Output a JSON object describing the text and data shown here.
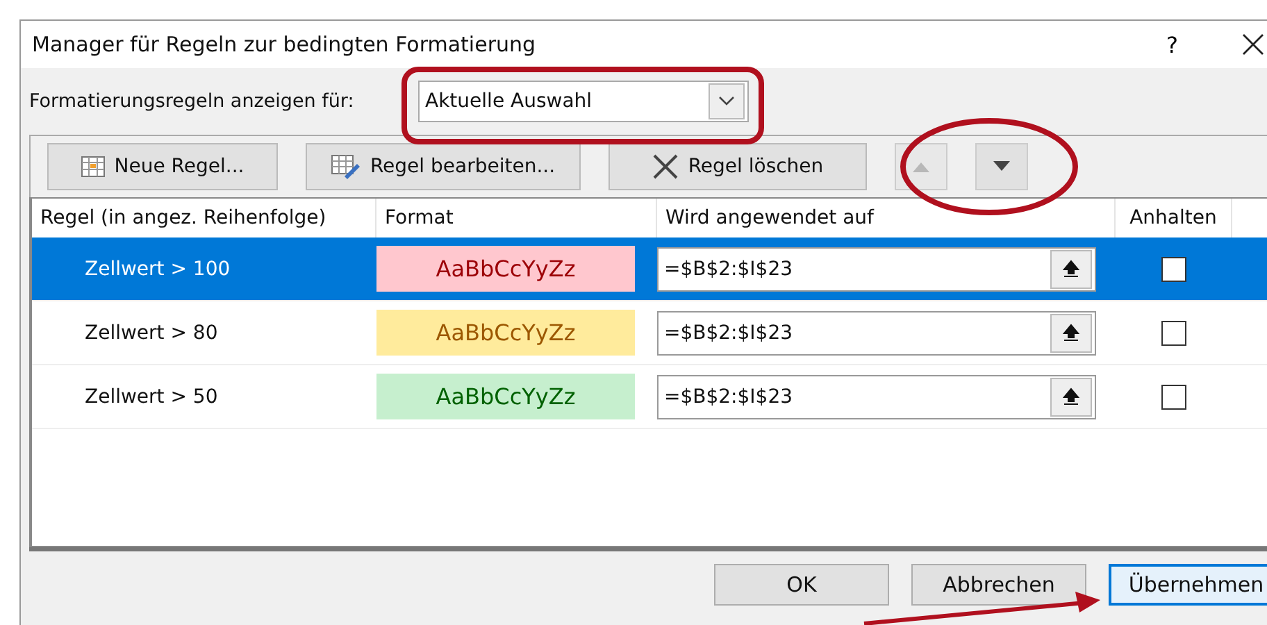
{
  "window": {
    "title": "Manager für Regeln zur bedingten Formatierung",
    "help": "?"
  },
  "filter": {
    "label": "Formatierungsregeln anzeigen für:",
    "value": "Aktuelle Auswahl"
  },
  "toolbar": [
    {
      "kind": "new",
      "label": "Neue Regel...",
      "disabled": false
    },
    {
      "kind": "edit",
      "label": "Regel bearbeiten...",
      "disabled": false
    },
    {
      "kind": "delete",
      "label": "Regel löschen",
      "disabled": false
    },
    {
      "kind": "up",
      "disabled": true
    },
    {
      "kind": "down",
      "disabled": false
    }
  ],
  "table": {
    "columns": [
      "Regel (in angez. Reihenfolge)",
      "Format",
      "Wird angewendet auf",
      "Anhalten"
    ],
    "rows": [
      {
        "rule": "Zellwert > 100",
        "format": {
          "kind": "bad",
          "color": "#ffc7ce",
          "sample": "AaBbCcYyZz"
        },
        "applies_to": "=$B$2:$I$23",
        "checked": false,
        "selected": true
      },
      {
        "rule": "Zellwert > 80",
        "format": {
          "kind": "neutral",
          "color": "#ffeb9c",
          "sample": "AaBbCcYyZz"
        },
        "applies_to": "=$B$2:$I$23",
        "checked": false,
        "selected": false
      },
      {
        "rule": "Zellwert > 50",
        "format": {
          "kind": "good",
          "color": "#c6efce",
          "sample": "AaBbCcYyZz"
        },
        "applies_to": "=$B$2:$I$23",
        "checked": false,
        "selected": false
      }
    ]
  },
  "buttons": [
    {
      "label": "OK",
      "focused": false
    },
    {
      "label": "Abbrechen",
      "focused": false
    },
    {
      "label": "Übernehmen",
      "focused": true
    }
  ]
}
